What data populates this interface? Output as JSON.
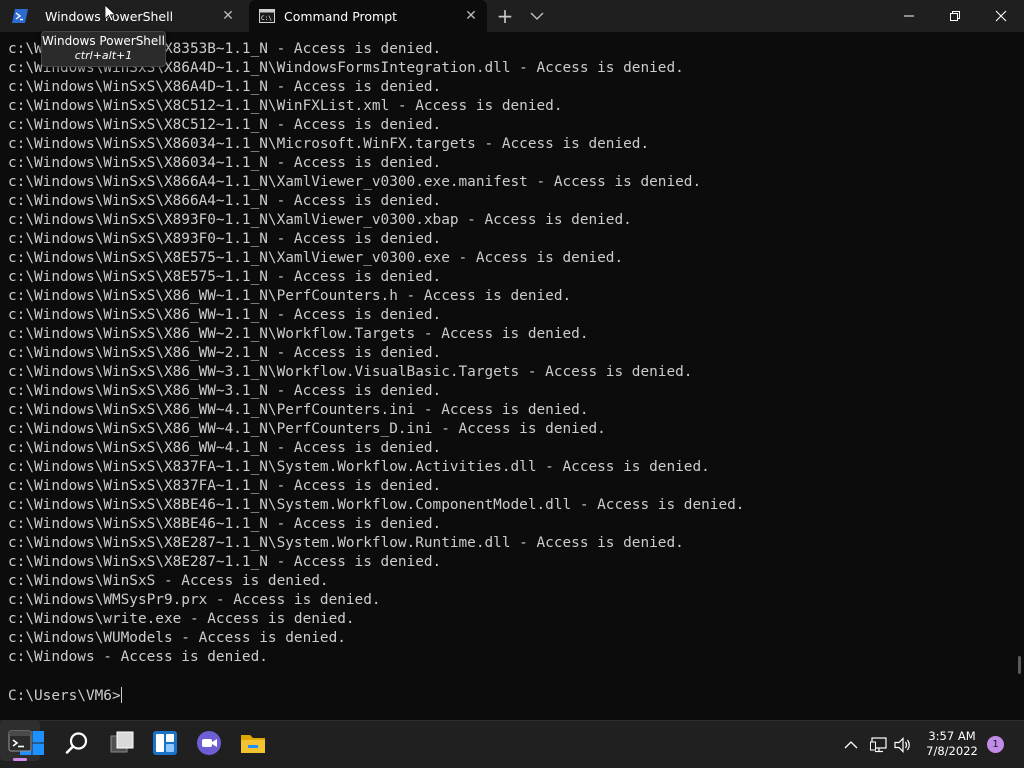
{
  "window": {
    "tabs": [
      {
        "label": "Windows PowerShell",
        "icon": "powershell-icon",
        "active": false
      },
      {
        "label": "Command Prompt",
        "icon": "command-prompt-icon",
        "active": true
      }
    ],
    "new_tab": "+",
    "close_glyph": "✕"
  },
  "tooltip": {
    "title": "Windows PowerShell",
    "shortcut": "ctrl+alt+1"
  },
  "console": {
    "lines": [
      "c:\\Windows\\WinSxS\\X8353B~1.1_N - Access is denied.",
      "c:\\Windows\\WinSxS\\X86A4D~1.1_N\\WindowsFormsIntegration.dll - Access is denied.",
      "c:\\Windows\\WinSxS\\X86A4D~1.1_N - Access is denied.",
      "c:\\Windows\\WinSxS\\X8C512~1.1_N\\WinFXList.xml - Access is denied.",
      "c:\\Windows\\WinSxS\\X8C512~1.1_N - Access is denied.",
      "c:\\Windows\\WinSxS\\X86034~1.1_N\\Microsoft.WinFX.targets - Access is denied.",
      "c:\\Windows\\WinSxS\\X86034~1.1_N - Access is denied.",
      "c:\\Windows\\WinSxS\\X866A4~1.1_N\\XamlViewer_v0300.exe.manifest - Access is denied.",
      "c:\\Windows\\WinSxS\\X866A4~1.1_N - Access is denied.",
      "c:\\Windows\\WinSxS\\X893F0~1.1_N\\XamlViewer_v0300.xbap - Access is denied.",
      "c:\\Windows\\WinSxS\\X893F0~1.1_N - Access is denied.",
      "c:\\Windows\\WinSxS\\X8E575~1.1_N\\XamlViewer_v0300.exe - Access is denied.",
      "c:\\Windows\\WinSxS\\X8E575~1.1_N - Access is denied.",
      "c:\\Windows\\WinSxS\\X86_WW~1.1_N\\PerfCounters.h - Access is denied.",
      "c:\\Windows\\WinSxS\\X86_WW~1.1_N - Access is denied.",
      "c:\\Windows\\WinSxS\\X86_WW~2.1_N\\Workflow.Targets - Access is denied.",
      "c:\\Windows\\WinSxS\\X86_WW~2.1_N - Access is denied.",
      "c:\\Windows\\WinSxS\\X86_WW~3.1_N\\Workflow.VisualBasic.Targets - Access is denied.",
      "c:\\Windows\\WinSxS\\X86_WW~3.1_N - Access is denied.",
      "c:\\Windows\\WinSxS\\X86_WW~4.1_N\\PerfCounters.ini - Access is denied.",
      "c:\\Windows\\WinSxS\\X86_WW~4.1_N\\PerfCounters_D.ini - Access is denied.",
      "c:\\Windows\\WinSxS\\X86_WW~4.1_N - Access is denied.",
      "c:\\Windows\\WinSxS\\X837FA~1.1_N\\System.Workflow.Activities.dll - Access is denied.",
      "c:\\Windows\\WinSxS\\X837FA~1.1_N - Access is denied.",
      "c:\\Windows\\WinSxS\\X8BE46~1.1_N\\System.Workflow.ComponentModel.dll - Access is denied.",
      "c:\\Windows\\WinSxS\\X8BE46~1.1_N - Access is denied.",
      "c:\\Windows\\WinSxS\\X8E287~1.1_N\\System.Workflow.Runtime.dll - Access is denied.",
      "c:\\Windows\\WinSxS\\X8E287~1.1_N - Access is denied.",
      "c:\\Windows\\WinSxS - Access is denied.",
      "c:\\Windows\\WMSysPr9.prx - Access is denied.",
      "c:\\Windows\\write.exe - Access is denied.",
      "c:\\Windows\\WUModels - Access is denied.",
      "c:\\Windows - Access is denied."
    ],
    "prompt": "C:\\Users\\VM6>"
  },
  "taskbar": {
    "items": [
      "start-icon",
      "search-icon",
      "task-view-icon",
      "widgets-icon",
      "chat-icon",
      "file-explorer-icon",
      "terminal-icon"
    ],
    "time": "3:57 AM",
    "date": "7/8/2022",
    "notification_count": "1"
  },
  "colors": {
    "console_bg": "#0c0c0c",
    "console_fg": "#cccccc",
    "titlebar_bg": "#1f1f1f",
    "taskbar_bg": "#202020",
    "start_blue": "#1e90ff",
    "explorer_yellow": "#f4c430",
    "badge": "#c28be8"
  }
}
